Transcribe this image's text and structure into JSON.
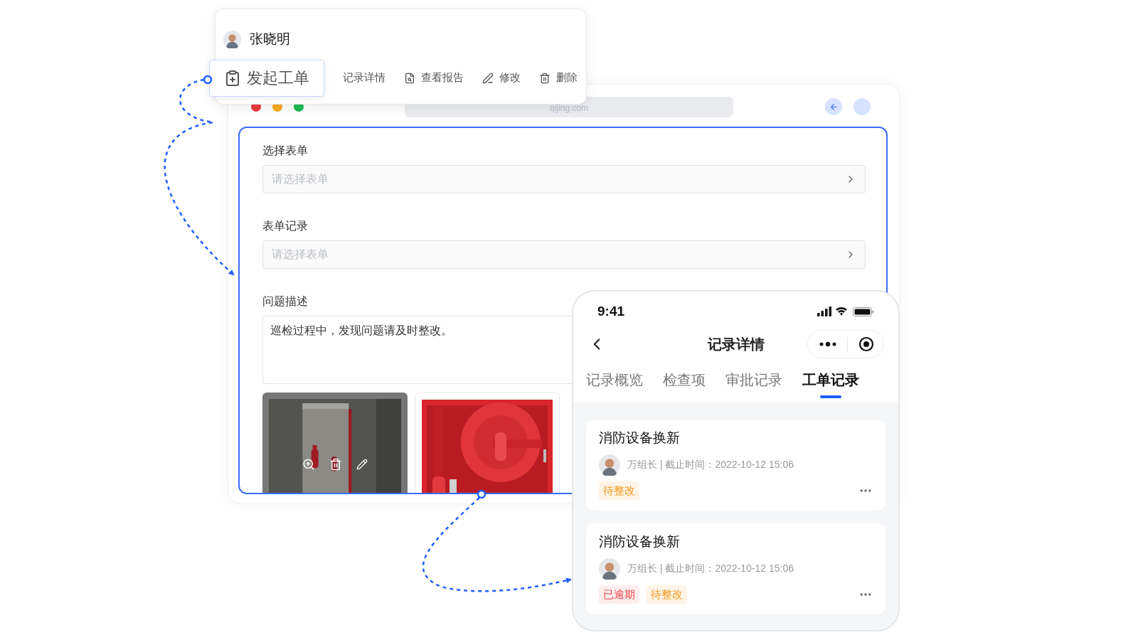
{
  "user_card": {
    "name": "张晓明",
    "actions": [
      {
        "label": "发起工单",
        "selected": true
      },
      {
        "label": "记录详情",
        "selected": false
      },
      {
        "label": "查看报告",
        "selected": false
      },
      {
        "label": "修改",
        "selected": false
      },
      {
        "label": "删除",
        "selected": false
      }
    ]
  },
  "browser": {
    "url": "qijing.com"
  },
  "form": {
    "fields": [
      {
        "kind": "select",
        "label": "选择表单",
        "placeholder": "请选择表单"
      },
      {
        "kind": "select",
        "label": "表单记录",
        "placeholder": "请选择表单"
      },
      {
        "kind": "textarea",
        "label": "问题描述",
        "value": "巡检过程中，发现问题请及时整改。"
      }
    ],
    "photos": [
      {
        "kind": "picture",
        "selected": true
      },
      {
        "kind": "picture",
        "selected": false
      }
    ]
  },
  "phone": {
    "time": "9:41",
    "title": "记录详情",
    "tabs": [
      {
        "label": "记录概览",
        "selected": false
      },
      {
        "label": "检查项",
        "selected": false
      },
      {
        "label": "审批记录",
        "selected": false
      },
      {
        "label": "工单记录",
        "selected": true
      }
    ],
    "records": [
      {
        "title": "消防设备换新",
        "meta": "万组长 | 截止时间：2022-10-12 15:06",
        "tags": [
          {
            "kind": "pending",
            "label": "待整改"
          }
        ]
      },
      {
        "title": "消防设备换新",
        "meta": "万组长 | 截止时间：2022-10-12 15:06",
        "tags": [
          {
            "kind": "overdue",
            "label": "已逾期"
          },
          {
            "kind": "pending",
            "label": "待整改"
          }
        ]
      }
    ]
  }
}
